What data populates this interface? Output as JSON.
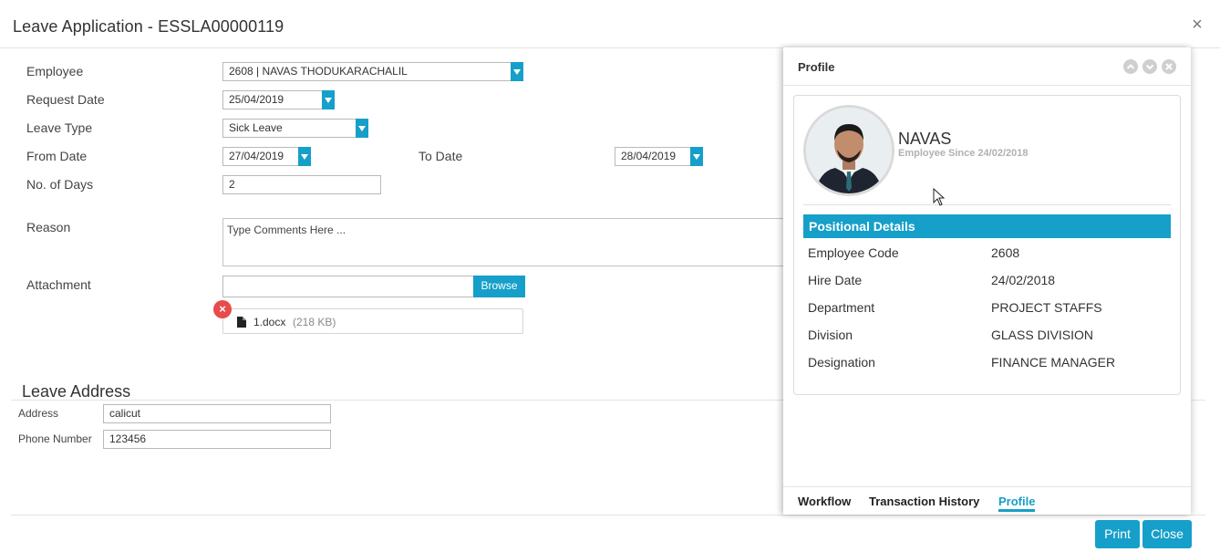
{
  "dialog": {
    "title": "Leave Application - ESSLA00000119",
    "close_glyph": "×"
  },
  "form": {
    "employee_label": "Employee",
    "employee_value": "2608 | NAVAS THODUKARACHALIL",
    "request_date_label": "Request Date",
    "request_date_value": "25/04/2019",
    "leave_type_label": "Leave Type",
    "leave_type_value": "Sick Leave",
    "from_date_label": "From Date",
    "from_date_value": "27/04/2019",
    "to_date_label": "To Date",
    "to_date_value": "28/04/2019",
    "days_label": "No. of Days",
    "days_value": "2",
    "reason_label": "Reason",
    "reason_placeholder": "Type Comments Here ...",
    "attachment_label": "Attachment",
    "browse_label": "Browse",
    "file_name": "1.docx",
    "file_size": "(218 KB)"
  },
  "leave_address": {
    "title": "Leave Address",
    "address_label": "Address",
    "address_value": "calicut",
    "phone_label": "Phone Number",
    "phone_value": "123456"
  },
  "footer": {
    "print_label": "Print",
    "close_label": "Close"
  },
  "profile_panel": {
    "title": "Profile",
    "name": "NAVAS",
    "since": "Employee Since 24/02/2018",
    "section_title": "Positional Details",
    "details": [
      {
        "label": "Employee Code",
        "value": "2608"
      },
      {
        "label": "Hire Date",
        "value": "24/02/2018"
      },
      {
        "label": "Department",
        "value": "PROJECT STAFFS"
      },
      {
        "label": "Division",
        "value": "GLASS DIVISION"
      },
      {
        "label": "Designation",
        "value": "FINANCE MANAGER"
      }
    ],
    "tabs": [
      {
        "label": "Workflow",
        "active": false
      },
      {
        "label": "Transaction History",
        "active": false
      },
      {
        "label": "Profile",
        "active": true
      }
    ]
  },
  "colors": {
    "accent": "#169fc9",
    "remove": "#e84b4b"
  },
  "icons": [
    "close-icon",
    "dropdown-arrow-icon",
    "file-icon",
    "remove-icon",
    "chevron-up-icon",
    "chevron-down-icon",
    "panel-close-icon",
    "avatar",
    "cursor-icon"
  ]
}
